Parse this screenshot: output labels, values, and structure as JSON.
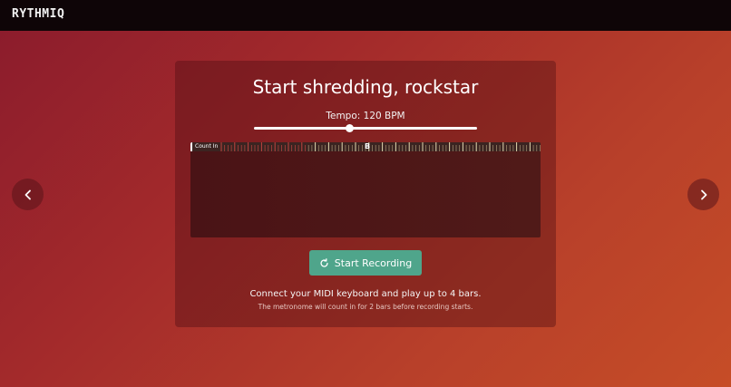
{
  "app": {
    "logo": "RYTHMIQ"
  },
  "nav": {
    "prev_icon": "chevron-left-icon",
    "next_icon": "chevron-right-icon"
  },
  "card": {
    "title": "Start shredding, rockstar",
    "tempo_label": "Tempo: 120 BPM",
    "tempo_slider_fraction": 0.43
  },
  "piano_roll": {
    "count_in_label": "Count In",
    "bar_marker": "B"
  },
  "record": {
    "label": "Start Recording",
    "icon": "refresh-icon",
    "color": "#4fa58b"
  },
  "info": {
    "main": "Connect your MIDI keyboard and play up to 4 bars.",
    "sub": "The metronome will count in for 2 bars before recording starts."
  }
}
